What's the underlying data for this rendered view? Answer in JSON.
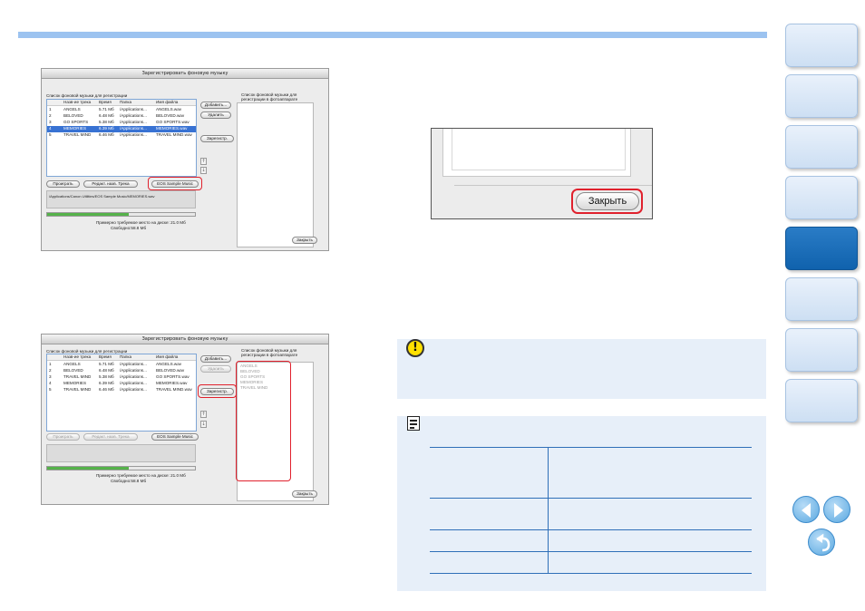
{
  "dialog1": {
    "title": "Зарегистрировать фоновую музыку",
    "list_label": "Список фоновой музыки для регистрации",
    "right_label_line1": "Список фоновой музыки для",
    "right_label_line2": "регистрации в фотоаппарате",
    "columns": [
      "Назв-ие трека",
      "Время",
      "Папка",
      "Имя файла"
    ],
    "rows": [
      [
        "1",
        "ANGELS",
        "5.71 Мб",
        "/Applications...",
        "ANGELS.wav"
      ],
      [
        "2",
        "BELOVED",
        "6.48 Мб",
        "/Applications...",
        "BELOVED.wav"
      ],
      [
        "3",
        "GO SPORTS",
        "5.38 Мб",
        "/Applications...",
        "GO SPORTS.wav"
      ],
      [
        "4",
        "MEMORIES",
        "6.39 Мб",
        "/Applications...",
        "MEMORIES.wav"
      ],
      [
        "5",
        "TRAVEL MIND",
        "6.46 Мб",
        "/Applications...",
        "TRAVEL MIND.wav"
      ]
    ],
    "selected_row": 3,
    "add_button": "Добавить...",
    "delete_button": "Удалить",
    "register_button": "Зарегистр.",
    "play_button": "Проиграть",
    "edit_button": "Редакт. назв. Трека",
    "sample_button": "EOS Sample Music",
    "path": "/Applications/Canon Utilities/EOS Sample Music/MEMORIES.wav",
    "progress": 0.55,
    "space_required": "Примерно требуемое место на диске: 21.0 Мб",
    "space_free": "Свободно:58.8 Мб",
    "close_button": "Закрыть"
  },
  "dialog2": {
    "title": "Зарегистрировать фоновую музыку",
    "list_label": "Список фоновой музыки для регистрации",
    "right_label_line1": "Список фоновой музыки для",
    "right_label_line2": "регистрации в фотоаппарате",
    "columns": [
      "Назв-ие трека",
      "Время",
      "Папка",
      "Имя файла"
    ],
    "rows": [
      [
        "1",
        "ANGELS",
        "5.71 Мб",
        "/Applications...",
        "ANGELS.wav"
      ],
      [
        "2",
        "BELOVED",
        "6.48 Мб",
        "/Applications...",
        "BELOVED.wav"
      ],
      [
        "3",
        "TRAVEL MIND",
        "5.38 Мб",
        "/Applications...",
        "GO SPORTS.wav"
      ],
      [
        "4",
        "MEMORIES",
        "6.39 Мб",
        "/Applications...",
        "MEMORIES.wav"
      ],
      [
        "5",
        "TRAVEL MIND",
        "6.46 Мб",
        "/Applications...",
        "TRAVEL MIND.wav"
      ]
    ],
    "registered": [
      "ANGELS",
      "BELOVED",
      "GO SPORTS",
      "MEMORIES",
      "TRAVEL MIND"
    ],
    "add_button": "Добавить...",
    "delete_button": "Удалить",
    "register_button": "Зарегистр.",
    "play_button": "Проиграть",
    "edit_button": "Редакт. назв. Трека",
    "sample_button": "EOS Sample Music",
    "progress": 0.55,
    "space_required": "Примерно требуемое место на диске: 21.0 Мб",
    "space_free": "Свободно:58.8 Мб",
    "close_button": "Закрыть"
  },
  "close_crop": {
    "close_button": "Закрыть"
  },
  "colors": {
    "accent": "#9cc3f0",
    "highlight": "#e0212d",
    "nav_active": "#1a6fbd",
    "panel": "#e7eff9"
  },
  "icons": {
    "caution": "caution-icon",
    "memo": "memo-icon",
    "prev": "prev-page-icon",
    "next": "next-page-icon",
    "back": "return-icon"
  }
}
